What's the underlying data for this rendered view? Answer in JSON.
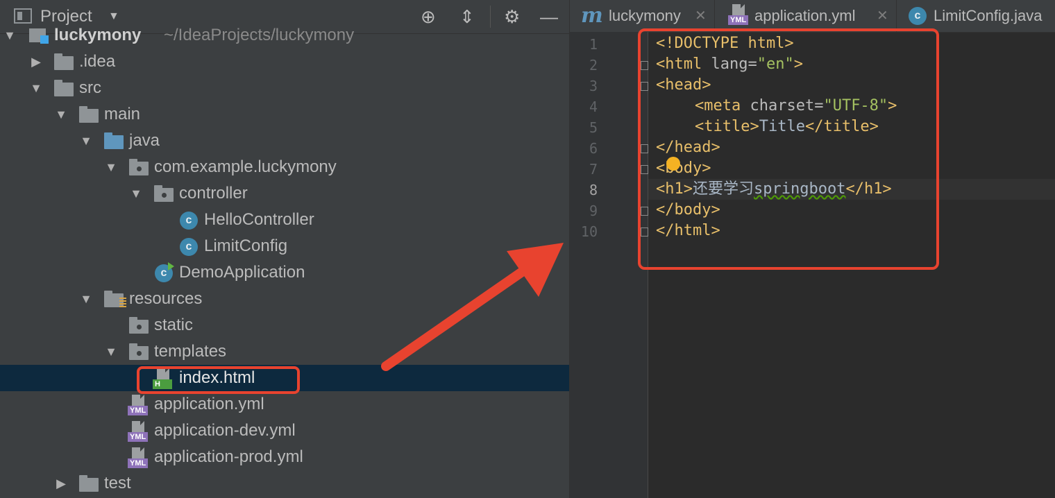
{
  "project_panel": {
    "header": {
      "title": "Project"
    },
    "tree": [
      {
        "label": "luckymony",
        "path": "~/IdeaProjects/luckymony",
        "expanded": true
      },
      {
        "label": ".idea",
        "expanded": false
      },
      {
        "label": "src",
        "expanded": true
      },
      {
        "label": "main",
        "expanded": true
      },
      {
        "label": "java",
        "expanded": true
      },
      {
        "label": "com.example.luckymony",
        "expanded": true
      },
      {
        "label": "controller",
        "expanded": true
      },
      {
        "label": "HelloController"
      },
      {
        "label": "LimitConfig"
      },
      {
        "label": "DemoApplication"
      },
      {
        "label": "resources",
        "expanded": true
      },
      {
        "label": "static"
      },
      {
        "label": "templates",
        "expanded": true
      },
      {
        "label": "index.html",
        "selected": true
      },
      {
        "label": "application.yml"
      },
      {
        "label": "application-dev.yml"
      },
      {
        "label": "application-prod.yml"
      },
      {
        "label": "test",
        "expanded": false
      }
    ]
  },
  "editor": {
    "tabs": [
      {
        "label": "luckymony",
        "icon": "maven-m-icon"
      },
      {
        "label": "application.yml",
        "icon": "yml-file-icon"
      },
      {
        "label": "LimitConfig.java",
        "icon": "class-icon"
      }
    ],
    "line_numbers": [
      "1",
      "2",
      "3",
      "4",
      "5",
      "6",
      "7",
      "8",
      "9",
      "10"
    ],
    "current_line": "8",
    "code": {
      "l1": "<!DOCTYPE html>",
      "l2_open": "<html",
      "l2_attr": " lang=",
      "l2_val": "\"en\"",
      "l2_close": ">",
      "l3": "<head>",
      "l4_open": "<meta",
      "l4_attr": " charset=",
      "l4_val": "\"UTF-8\"",
      "l4_close": ">",
      "l5_open": "<title>",
      "l5_text": "Title",
      "l5_close": "</title>",
      "l6": "</head>",
      "l7": "<body>",
      "l8_open": "<h1>",
      "l8_text": "还要学习",
      "l8_typo": "springboot",
      "l8_close": "</h1>",
      "l9": "</body>",
      "l10": "</html>"
    }
  },
  "annotation_color": "#e8432f"
}
